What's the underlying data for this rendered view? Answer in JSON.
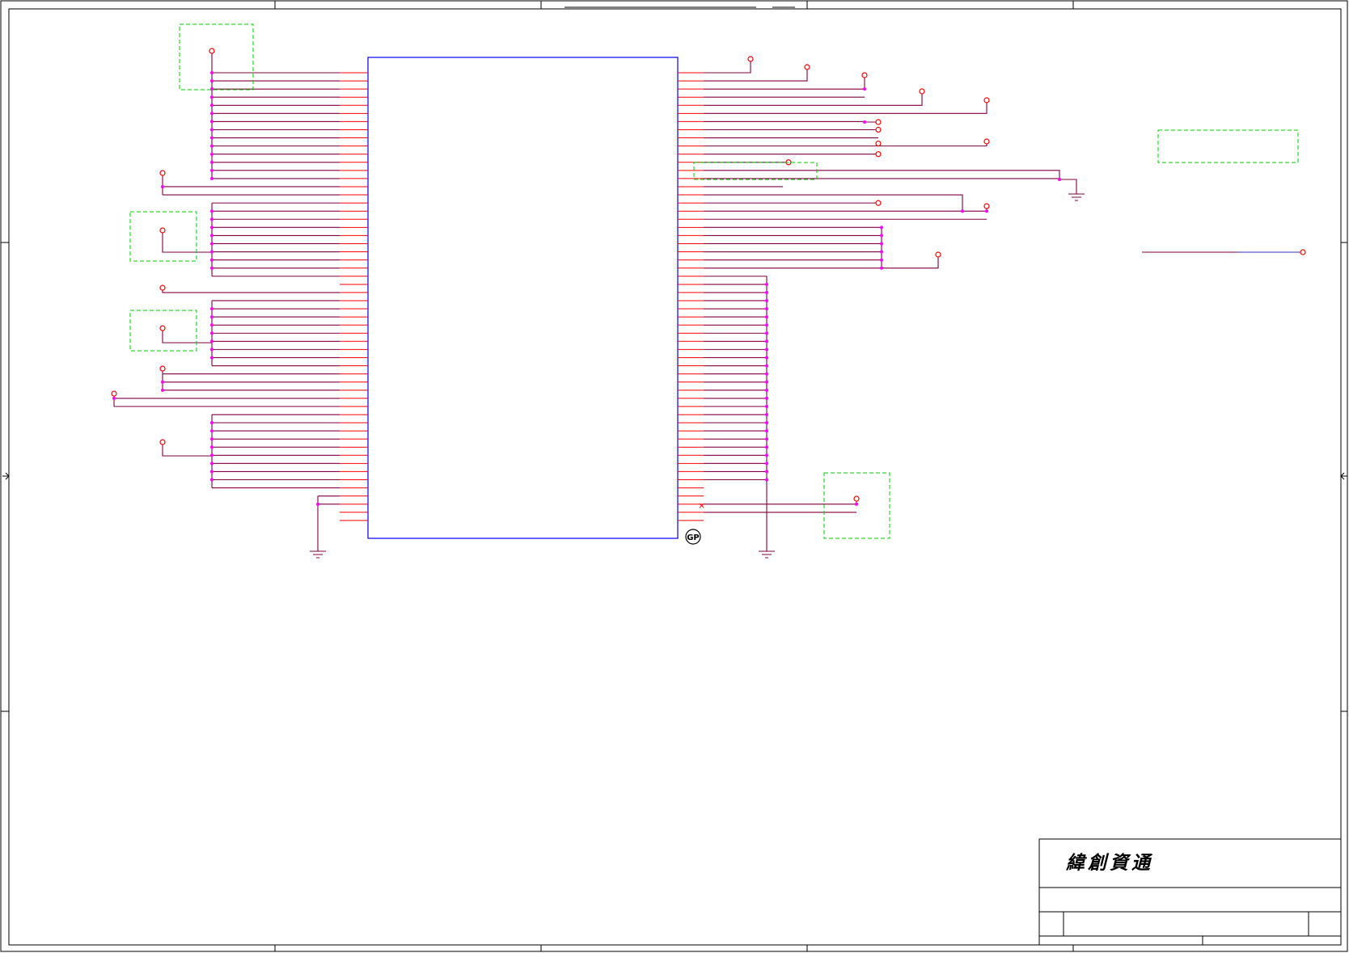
{
  "title_block": {
    "company_name": "緯創資通"
  },
  "symbols": {
    "no_connect": "×",
    "green_part_mark": "GP"
  },
  "colors": {
    "border": "#000000",
    "pin": "#ff0000",
    "net": "#800040",
    "junction": "#ff00ff",
    "component_outline": "#0000ff",
    "group_box": "#00cc00",
    "power_port": "#ff0000"
  }
}
